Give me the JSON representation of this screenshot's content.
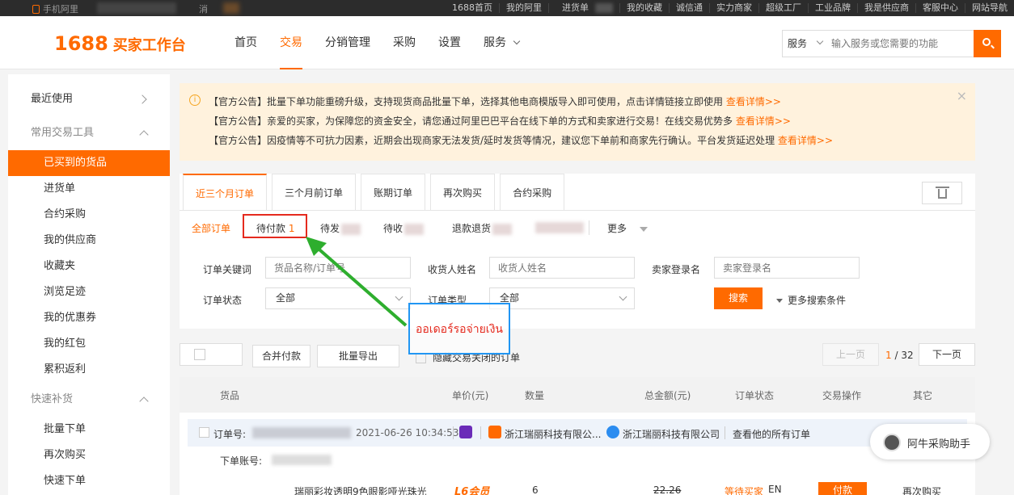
{
  "topbar": {
    "mobile": "手机阿里",
    "message": "消",
    "links": [
      "1688首页",
      "我的阿里",
      "进货单",
      "我的收藏",
      "诚信通",
      "实力商家",
      "超级工厂",
      "工业品牌",
      "我是供应商",
      "客服中心",
      "网站导航"
    ]
  },
  "header": {
    "logo_num": "1688",
    "logo_text": "买家工作台",
    "nav": [
      "首页",
      "交易",
      "分销管理",
      "采购",
      "设置",
      "服务"
    ],
    "search_cat": "服务",
    "search_placeholder": "输入服务或您需要的功能"
  },
  "sidebar": {
    "recent": "最近使用",
    "common_tools": "常用交易工具",
    "items": [
      "已买到的货品",
      "进货单",
      "合约采购",
      "我的供应商",
      "收藏夹",
      "浏览足迹",
      "我的优惠券",
      "我的红包",
      "累积返利"
    ],
    "quick_restock": "快速补货",
    "quick_items": [
      "批量下单",
      "再次购买",
      "快速下单"
    ]
  },
  "notice": {
    "tag": "【官方公告】",
    "lines": [
      {
        "text": "批量下单功能重磅升级，支持现货商品批量下单，选择其他电商模版导入即可使用，点击详情链接立即使用 ",
        "link": "查看详情>>"
      },
      {
        "text": "亲爱的买家，为保障您的资金安全，请您通过阿里巴巴平台在线下单的方式和卖家进行交易！在线交易优势多 ",
        "link": "查看详情>>"
      },
      {
        "text": "因疫情等不可抗力因素，近期会出现商家无法发货/延时发货等情况，建议您下单前和商家先行确认。平台发货延迟处理 ",
        "link": "查看详情>>"
      }
    ]
  },
  "tabs": [
    "近三个月订单",
    "三个月前订单",
    "账期订单",
    "再次购买",
    "合约采购"
  ],
  "status_tabs": {
    "all": "全部订单",
    "pending_pay": "待付款",
    "pending_pay_count": "1",
    "pending_ship": "待发",
    "pending_recv": "待收",
    "refund": "退款退货",
    "more": "更多"
  },
  "filters": {
    "keyword_label": "订单关键词",
    "keyword_placeholder": "货品名称/订单号",
    "receiver_label": "收货人姓名",
    "receiver_placeholder": "收货人姓名",
    "seller_label": "卖家登录名",
    "seller_placeholder": "卖家登录名",
    "status_label": "订单状态",
    "status_value": "全部",
    "type_label": "订单类型",
    "type_value": "全部",
    "search_btn": "搜索",
    "more_cond": "更多搜索条件"
  },
  "annotation": "ออเดอร์รอจ่ายเงิน",
  "toolbar": {
    "merge_pay": "合并付款",
    "batch_export": "批量导出",
    "hide_closed": "隐藏交易关闭的订单",
    "prev": "上一页",
    "page_current": "1",
    "page_total": "/ 32",
    "next": "下一页"
  },
  "table_headers": [
    "货品",
    "单价(元)",
    "数量",
    "总金额(元)",
    "订单状态",
    "交易操作",
    "其它"
  ],
  "order": {
    "no_label": "订单号:",
    "time": "2021-06-26 10:34:53",
    "seller1": "浙江瑞丽科技有限公...",
    "seller2": "浙江瑞丽科技有限公司",
    "see_all": "查看他的所有订单",
    "account_label": "下单账号:",
    "item_title": "瑞丽彩妆透明9色眼影哑光珠光",
    "member": "L6会员",
    "qty": "6",
    "price": "22.26",
    "status": "等待买家",
    "en": "EN",
    "pay_btn": "付款",
    "rebuy": "再次购买"
  },
  "assistant": "阿牛采购助手"
}
